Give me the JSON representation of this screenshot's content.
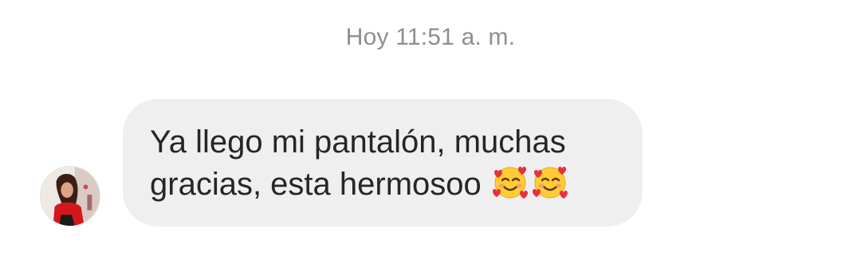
{
  "thread": {
    "timestamp": "Hoy 11:51 a. m."
  },
  "message": {
    "line1": "Ya llego mi pantalón, muchas",
    "line2": "gracias, esta hermosoo",
    "emojis": [
      "smiling-face-with-hearts-icon",
      "smiling-face-with-hearts-icon"
    ]
  },
  "colors": {
    "bubble": "#efefef",
    "text": "#262626",
    "timestamp": "#8e8e8e"
  }
}
